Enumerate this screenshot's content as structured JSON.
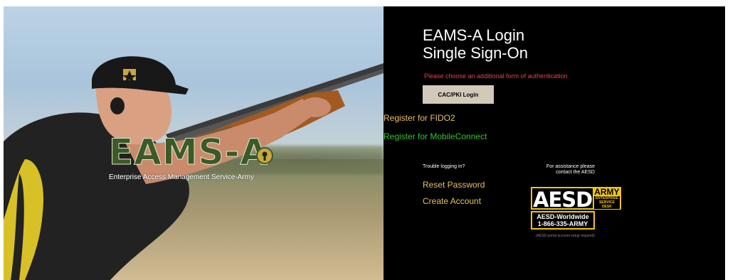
{
  "hero": {
    "logo_word": "EAMS-A",
    "logo_tagline": "Enterprise Access Management Service-Army",
    "logo_color": "#3c5a27"
  },
  "login": {
    "title_line1": "EAMS-A Login",
    "title_line2": "Single Sign-On",
    "auth_message": "Please choose an additional form of authentication",
    "cac_button_label": "CAC/PKI Login",
    "register_fido_label": "Register for FIDO2",
    "register_mobile_label": "Register for MobileConnect",
    "trouble_text": "Trouble logging in?",
    "reset_password_label": "Reset Password",
    "create_account_label": "Create Account"
  },
  "assistance": {
    "text_line1": "For assistance please",
    "text_line2": "contact the AESD",
    "aesd_word": "AESD",
    "aesd_army": "ARMY",
    "aesd_enterprise": "ENTERPRISE",
    "aesd_service_desk": "SERVICE DESK",
    "aesd_worldwide": "AESD-Worldwide",
    "aesd_phone": "1-866-335-ARMY",
    "note": "(AESD portal account setup required)"
  },
  "colors": {
    "panel_background": "#000000",
    "link_gold": "#e6c063",
    "link_green": "#33c52b",
    "message_red": "#e0473f",
    "button_background": "#d2c9b9",
    "aesd_yellow": "#f0c419"
  }
}
